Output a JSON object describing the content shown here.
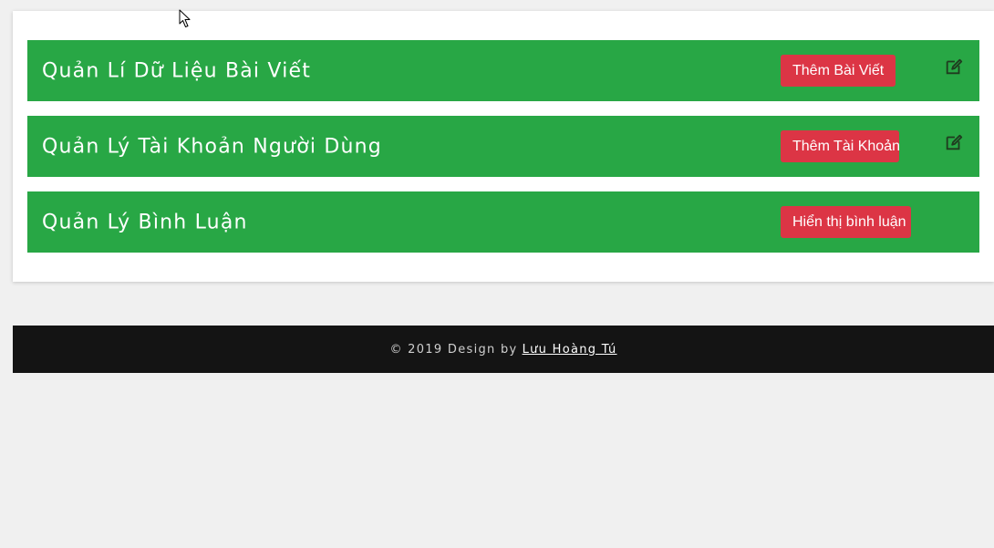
{
  "rows": [
    {
      "title": "Quản Lí Dữ Liệu Bài Viết",
      "button": "Thêm Bài Viết",
      "icon": "edit-icon"
    },
    {
      "title": "Quản Lý Tài Khoản Người Dùng",
      "button": "Thêm Tài Khoản",
      "icon": "edit-icon"
    },
    {
      "title": "Quản Lý Bình Luận",
      "button": "Hiển thị bình luận"
    }
  ],
  "footer": {
    "text": "© 2019 Design by",
    "author": "Lưu Hoàng Tú"
  },
  "colors": {
    "row_bg": "#28a745",
    "button_bg": "#dc3545",
    "footer_bg": "#141414",
    "page_bg": "#f0f0f0"
  }
}
